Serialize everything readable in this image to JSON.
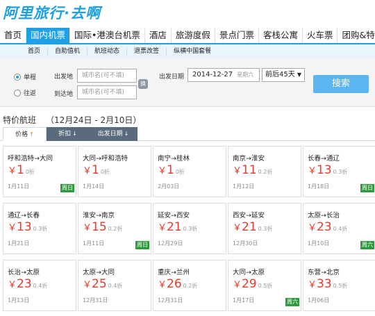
{
  "logo": {
    "text": "阿里旅行·去啊"
  },
  "main_nav": [
    {
      "label": "首页",
      "active": false
    },
    {
      "label": "国内机票",
      "active": true
    },
    {
      "label": "国际•港澳台机票",
      "active": false
    },
    {
      "label": "酒店",
      "active": false
    },
    {
      "label": "旅游度假",
      "active": false
    },
    {
      "label": "景点门票",
      "active": false
    },
    {
      "label": "客栈公寓",
      "active": false
    },
    {
      "label": "火车票",
      "active": false
    },
    {
      "label": "团购&特卖",
      "active": false
    }
  ],
  "sub_nav": [
    "首页",
    "自助值机",
    "航班动态",
    "退票改签",
    "纵横中国套餐"
  ],
  "search": {
    "trip_types": [
      {
        "label": "单程",
        "selected": true
      },
      {
        "label": "往返",
        "selected": false
      }
    ],
    "from_label": "出发地",
    "to_label": "到达地",
    "city_placeholder": "城市名(可不填)",
    "swap_label": "换",
    "date_label": "出发日期",
    "date_value": "2014-12-27",
    "date_weekday": "星期六",
    "range_value": "前后45天",
    "button_label": "搜索"
  },
  "section": {
    "title": "特价航班",
    "date_range": "（12月24日 - 2月10日）"
  },
  "sort_tabs": [
    {
      "label": "价格",
      "arrow": "↑",
      "active": true
    },
    {
      "label": "折扣",
      "arrow": "↓",
      "active": false
    },
    {
      "label": "出发日期",
      "arrow": "↓",
      "active": false
    }
  ],
  "currency": "￥",
  "deals": [
    {
      "route": "呼和浩特→大同",
      "price": "1",
      "discount": "0折",
      "date": "1月11日",
      "badge": "周日"
    },
    {
      "route": "大同→呼和浩特",
      "price": "1",
      "discount": "0折",
      "date": "1月14日",
      "badge": ""
    },
    {
      "route": "南宁→桂林",
      "price": "1",
      "discount": "0折",
      "date": "2月03日",
      "badge": ""
    },
    {
      "route": "南京→淮安",
      "price": "11",
      "discount": "0.2折",
      "date": "1月12日",
      "badge": ""
    },
    {
      "route": "长春→通辽",
      "price": "13",
      "discount": "0.3折",
      "date": "1月18日",
      "badge": "周日"
    },
    {
      "route": "通辽→长春",
      "price": "13",
      "discount": "0.3折",
      "date": "1月21日",
      "badge": ""
    },
    {
      "route": "淮安→南京",
      "price": "15",
      "discount": "0.2折",
      "date": "1月11日",
      "badge": "周日"
    },
    {
      "route": "延安→西安",
      "price": "21",
      "discount": "0.3折",
      "date": "12月29日",
      "badge": ""
    },
    {
      "route": "西安→延安",
      "price": "21",
      "discount": "0.3折",
      "date": "12月30日",
      "badge": ""
    },
    {
      "route": "太原→长治",
      "price": "23",
      "discount": "0.4折",
      "date": "1月10日",
      "badge": "周六"
    },
    {
      "route": "长治→太原",
      "price": "23",
      "discount": "0.4折",
      "date": "1月13日",
      "badge": ""
    },
    {
      "route": "太原→大同",
      "price": "25",
      "discount": "0.4折",
      "date": "12月31日",
      "badge": ""
    },
    {
      "route": "重庆→兰州",
      "price": "26",
      "discount": "0.2折",
      "date": "12月31日",
      "badge": ""
    },
    {
      "route": "大同→太原",
      "price": "29",
      "discount": "0.5折",
      "date": "1月17日",
      "badge": "周六"
    },
    {
      "route": "东营→北京",
      "price": "33",
      "discount": "0.5折",
      "date": "1月06日",
      "badge": ""
    }
  ]
}
